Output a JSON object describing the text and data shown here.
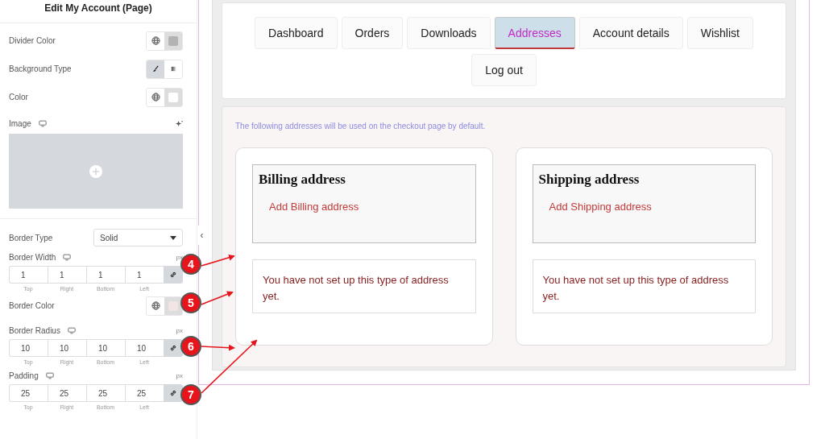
{
  "panel": {
    "title": "Edit My Account (Page)",
    "controls": [
      {
        "kind": "color",
        "label": "Divider Color",
        "color": "#b3b3b3"
      },
      {
        "kind": "choose",
        "label": "Background Type",
        "options": [
          {
            "selected": true
          },
          {
            "selected": false
          }
        ]
      },
      {
        "kind": "color",
        "label": "Color",
        "color": "#ffffff"
      },
      {
        "kind": "media",
        "label": "Image",
        "responsive": true
      },
      {
        "kind": "select",
        "label": "Border Type",
        "value": "Solid"
      },
      {
        "kind": "dimensions",
        "label": "Border Width",
        "responsive": true,
        "unit": "px",
        "linked": true,
        "values": [
          {
            "value": "1",
            "side": "Top"
          },
          {
            "value": "1",
            "side": "Right"
          },
          {
            "value": "1",
            "side": "Bottom"
          },
          {
            "value": "1",
            "side": "Left"
          }
        ]
      },
      {
        "kind": "color",
        "label": "Border Color",
        "color": "#f4e4e4"
      },
      {
        "kind": "dimensions",
        "label": "Border Radius",
        "responsive": true,
        "unit": "px",
        "linked": true,
        "values": [
          {
            "value": "10",
            "side": "Top"
          },
          {
            "value": "10",
            "side": "Right"
          },
          {
            "value": "10",
            "side": "Bottom"
          },
          {
            "value": "10",
            "side": "Left"
          }
        ]
      },
      {
        "kind": "dimensions",
        "label": "Padding",
        "responsive": true,
        "unit": "px",
        "linked": true,
        "values": [
          {
            "value": "25",
            "side": "Top"
          },
          {
            "value": "25",
            "side": "Right"
          },
          {
            "value": "25",
            "side": "Bottom"
          },
          {
            "value": "25",
            "side": "Left"
          }
        ]
      }
    ]
  },
  "collapse_tab": "‹",
  "nav": [
    {
      "label": "Dashboard",
      "selected": false
    },
    {
      "label": "Orders",
      "selected": false
    },
    {
      "label": "Downloads",
      "selected": false
    },
    {
      "label": "Addresses",
      "selected": true
    },
    {
      "label": "Account details",
      "selected": false
    },
    {
      "label": "Wishlist",
      "selected": false
    },
    {
      "label": "Log out",
      "selected": false
    }
  ],
  "intro": "The following addresses will be used on the checkout page by default.",
  "addresses": [
    {
      "title": "Billing address",
      "link": "Add Billing address",
      "notice": "You have not set up this type of address yet."
    },
    {
      "title": "Shipping address",
      "link": "Add Shipping address",
      "notice": "You have not set up this type of address yet."
    }
  ],
  "callouts": [
    {
      "label": "4"
    },
    {
      "label": "5"
    },
    {
      "label": "6"
    },
    {
      "label": "7"
    }
  ]
}
